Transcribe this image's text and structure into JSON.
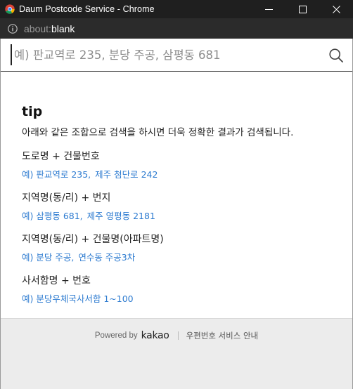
{
  "window": {
    "title": "Daum Postcode Service - Chrome",
    "icon": "chrome-icon",
    "controls": [
      "minimize-icon",
      "maximize-icon",
      "close-icon"
    ]
  },
  "addressbar": {
    "icon": "info-icon",
    "url_scheme": "about:",
    "url_host": "blank"
  },
  "search": {
    "value": "",
    "placeholder": "예) 판교역로 235, 분당 주공, 삼평동 681",
    "button_icon": "search-icon"
  },
  "tip": {
    "title": "tip",
    "description": "아래와 같은 조합으로 검색을 하시면 더욱 정확한 결과가 검색됩니다.",
    "groups": [
      {
        "label": "도로명 + 건물번호",
        "examples": [
          "예) 판교역로 235,",
          "제주 첨단로 242"
        ]
      },
      {
        "label": "지역명(동/리) + 번지",
        "examples": [
          "예) 삼평동 681,",
          "제주 영평동 2181"
        ]
      },
      {
        "label": "지역명(동/리) + 건물명(아파트명)",
        "examples": [
          "예) 분당 주공,",
          "연수동 주공3차"
        ]
      },
      {
        "label": "사서함명 + 번호",
        "examples": [
          "예) 분당우체국사서함 1~100"
        ]
      }
    ]
  },
  "footer": {
    "powered_by": "Powered by",
    "brand": "kakao",
    "guide_link": "우편번호 서비스 안내"
  },
  "colors": {
    "titlebar_bg": "#1f1f1f",
    "addressbar_bg": "#2b2b2b",
    "example_link": "#2d7bd0",
    "footer_bg": "#ececec"
  }
}
